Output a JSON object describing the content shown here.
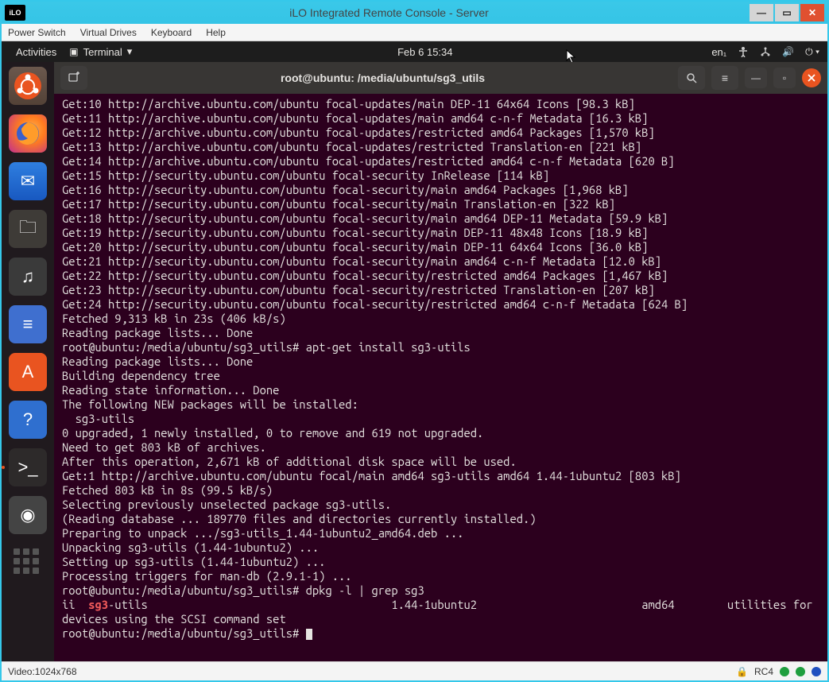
{
  "ilo": {
    "logo": "iLO",
    "title": "iLO Integrated Remote Console - Server",
    "menu": [
      "Power Switch",
      "Virtual Drives",
      "Keyboard",
      "Help"
    ]
  },
  "gnome": {
    "activities": "Activities",
    "app": "Terminal",
    "clock": "Feb 6  15:34",
    "lang": "en₁"
  },
  "terminal": {
    "title": "root@ubuntu: /media/ubuntu/sg3_utils",
    "lines": [
      "Get:10 http://archive.ubuntu.com/ubuntu focal-updates/main DEP-11 64x64 Icons [98.3 kB]",
      "Get:11 http://archive.ubuntu.com/ubuntu focal-updates/main amd64 c-n-f Metadata [16.3 kB]",
      "Get:12 http://archive.ubuntu.com/ubuntu focal-updates/restricted amd64 Packages [1,570 kB]",
      "Get:13 http://archive.ubuntu.com/ubuntu focal-updates/restricted Translation-en [221 kB]",
      "Get:14 http://archive.ubuntu.com/ubuntu focal-updates/restricted amd64 c-n-f Metadata [620 B]",
      "Get:15 http://security.ubuntu.com/ubuntu focal-security InRelease [114 kB]",
      "Get:16 http://security.ubuntu.com/ubuntu focal-security/main amd64 Packages [1,968 kB]",
      "Get:17 http://security.ubuntu.com/ubuntu focal-security/main Translation-en [322 kB]",
      "Get:18 http://security.ubuntu.com/ubuntu focal-security/main amd64 DEP-11 Metadata [59.9 kB]",
      "Get:19 http://security.ubuntu.com/ubuntu focal-security/main DEP-11 48x48 Icons [18.9 kB]",
      "Get:20 http://security.ubuntu.com/ubuntu focal-security/main DEP-11 64x64 Icons [36.0 kB]",
      "Get:21 http://security.ubuntu.com/ubuntu focal-security/main amd64 c-n-f Metadata [12.0 kB]",
      "Get:22 http://security.ubuntu.com/ubuntu focal-security/restricted amd64 Packages [1,467 kB]",
      "Get:23 http://security.ubuntu.com/ubuntu focal-security/restricted Translation-en [207 kB]",
      "Get:24 http://security.ubuntu.com/ubuntu focal-security/restricted amd64 c-n-f Metadata [624 B]",
      "Fetched 9,313 kB in 23s (406 kB/s)",
      "Reading package lists... Done",
      "root@ubuntu:/media/ubuntu/sg3_utils# apt-get install sg3-utils",
      "Reading package lists... Done",
      "Building dependency tree",
      "Reading state information... Done",
      "The following NEW packages will be installed:",
      "  sg3-utils",
      "0 upgraded, 1 newly installed, 0 to remove and 619 not upgraded.",
      "Need to get 803 kB of archives.",
      "After this operation, 2,671 kB of additional disk space will be used.",
      "Get:1 http://archive.ubuntu.com/ubuntu focal/main amd64 sg3-utils amd64 1.44-1ubuntu2 [803 kB]",
      "Fetched 803 kB in 8s (99.5 kB/s)",
      "Selecting previously unselected package sg3-utils.",
      "(Reading database ... 189770 files and directories currently installed.)",
      "Preparing to unpack .../sg3-utils_1.44-1ubuntu2_amd64.deb ...",
      "Unpacking sg3-utils (1.44-1ubuntu2) ...",
      "Setting up sg3-utils (1.44-1ubuntu2) ...",
      "Processing triggers for man-db (2.9.1-1) ...",
      "root@ubuntu:/media/ubuntu/sg3_utils# dpkg -l | grep sg3"
    ],
    "dpkg_line": {
      "prefix": "ii  ",
      "hl": "sg3",
      "rest": "-utils                                     1.44-1ubuntu2                         amd64        utilities for devices using the SCSI command set"
    },
    "prompt": "root@ubuntu:/media/ubuntu/sg3_utils# "
  },
  "dock": {
    "items": [
      {
        "name": "files-icon",
        "label": "◎",
        "cls": "files"
      },
      {
        "name": "firefox-icon",
        "label": "",
        "cls": "firefox"
      },
      {
        "name": "thunderbird-icon",
        "label": "✉",
        "cls": "thunder"
      },
      {
        "name": "nautilus-icon",
        "label": "🗀",
        "cls": "folder"
      },
      {
        "name": "rhythmbox-icon",
        "label": "♫",
        "cls": "music"
      },
      {
        "name": "libreoffice-icon",
        "label": "≡",
        "cls": "office"
      },
      {
        "name": "software-icon",
        "label": "A",
        "cls": "store"
      },
      {
        "name": "help-icon",
        "label": "?",
        "cls": "help"
      },
      {
        "name": "terminal-icon",
        "label": ">_",
        "cls": "term",
        "active": true
      },
      {
        "name": "disc-icon",
        "label": "◉",
        "cls": "disc"
      }
    ]
  },
  "status": {
    "video": "Video:1024x768",
    "enc": "RC4"
  }
}
